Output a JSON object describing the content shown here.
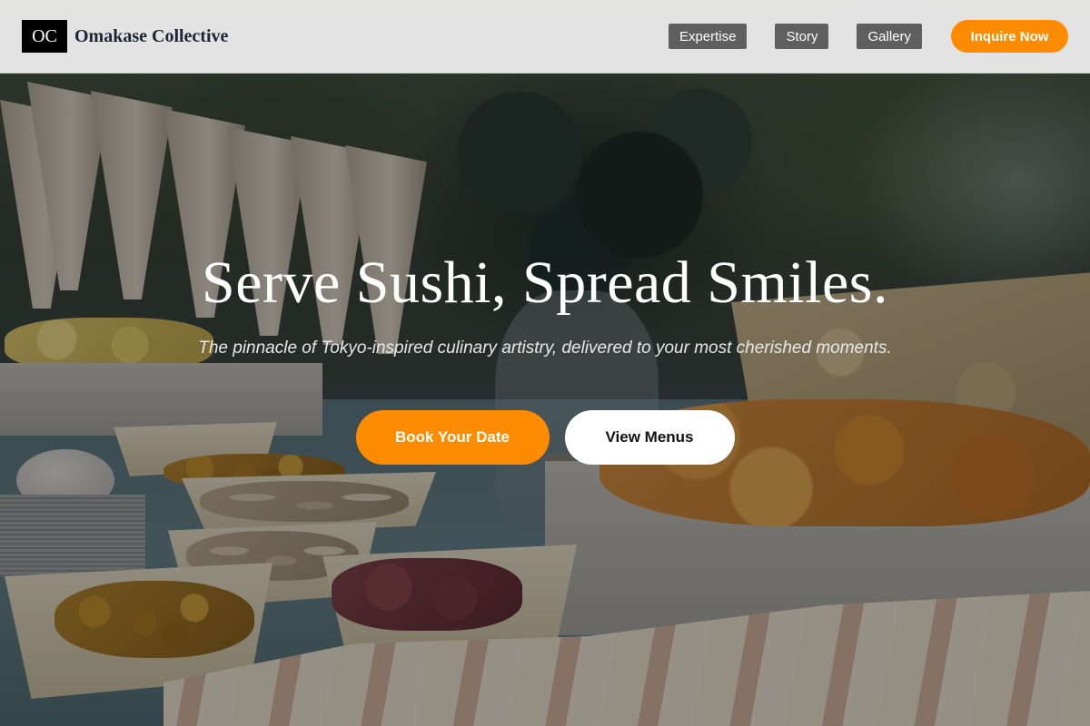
{
  "brand": {
    "mark": "OC",
    "name": "Omakase Collective"
  },
  "nav": {
    "links": [
      "Expertise",
      "Story",
      "Gallery"
    ],
    "inquire_label": "Inquire Now"
  },
  "hero": {
    "title": "Serve Sushi, Spread Smiles.",
    "subtitle": "The pinnacle of Tokyo-inspired culinary artistry, delivered to your most cherished moments.",
    "primary_cta": "Book Your Date",
    "secondary_cta": "View Menus"
  },
  "colors": {
    "accent": "#ff8c00",
    "header_bg": "#eaeaea",
    "nav_link_bg": "#5f5f5f"
  }
}
